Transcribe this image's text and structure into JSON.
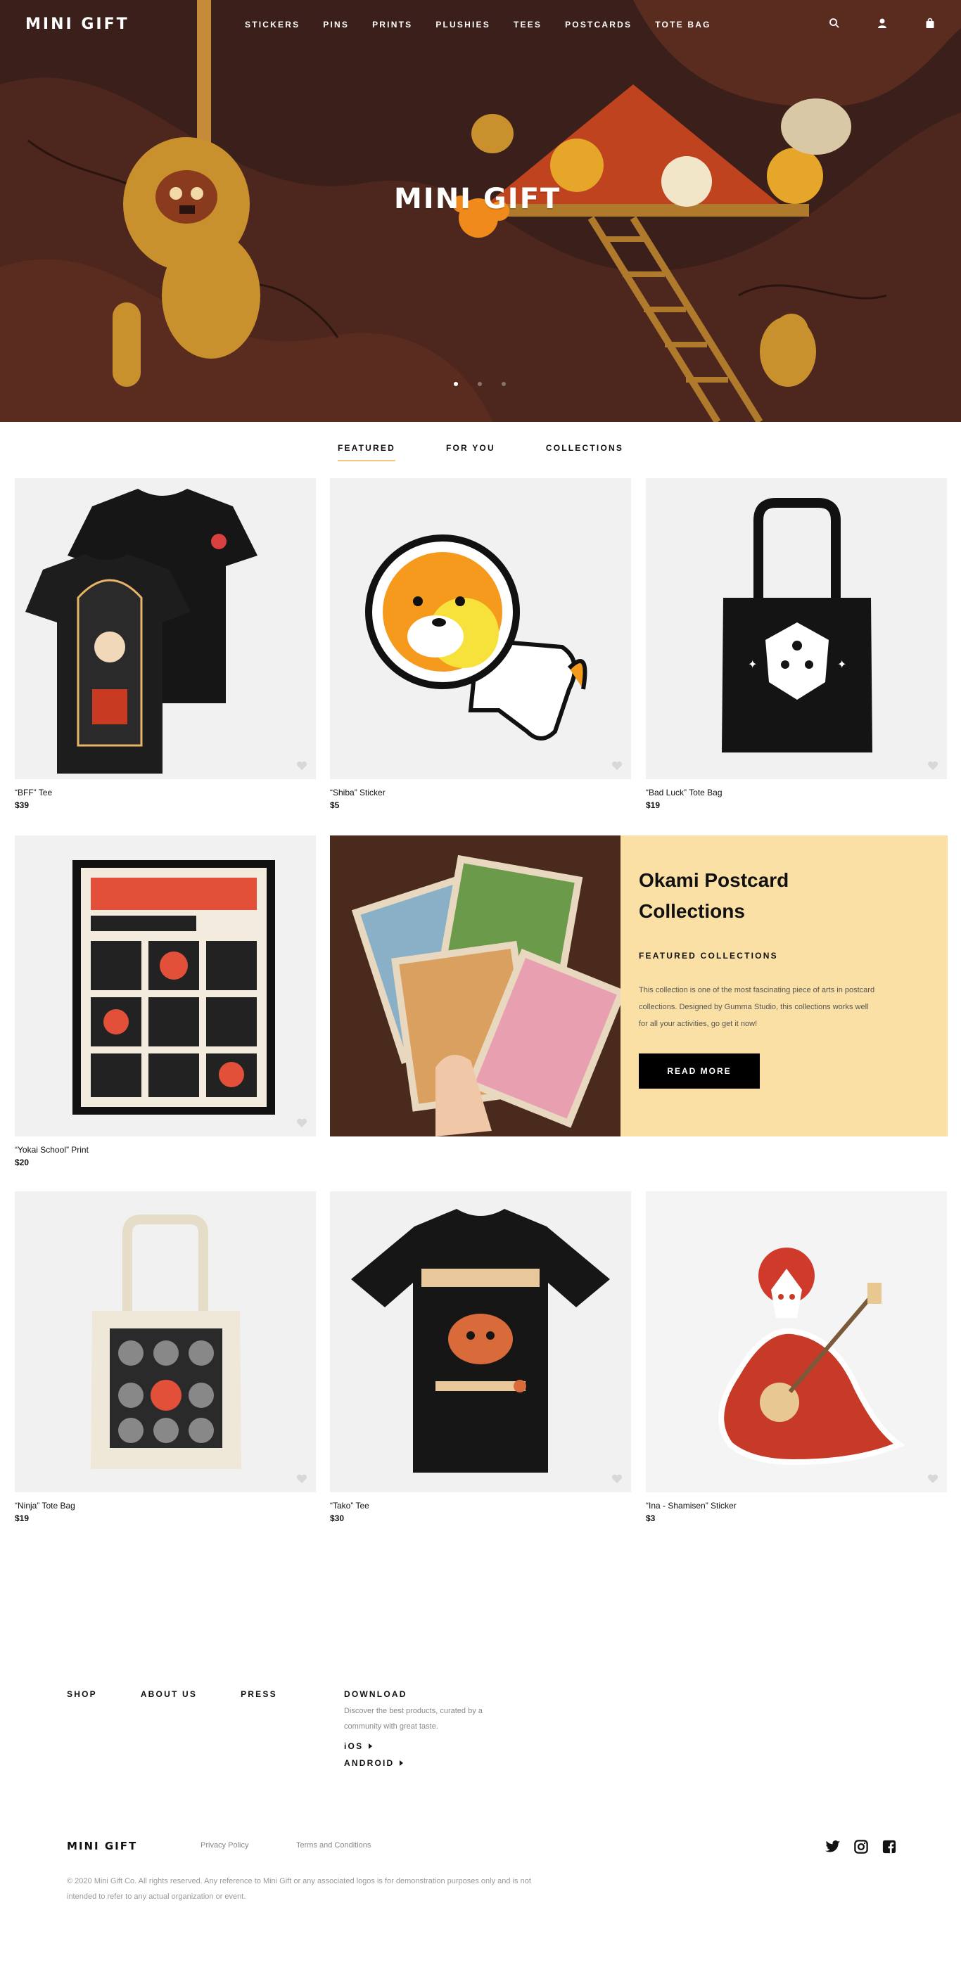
{
  "brand": {
    "logo": "MINI GIFT"
  },
  "nav": {
    "items": [
      "STICKERS",
      "PINS",
      "PRINTS",
      "PLUSHIES",
      "TEES",
      "POSTCARDS",
      "TOTE BAG"
    ],
    "icons": [
      "search-icon",
      "user-icon",
      "bag-icon"
    ]
  },
  "hero": {
    "title": "MINI GIFT",
    "slides": 3,
    "active_slide": 1
  },
  "tabs": [
    {
      "label": "FEATURED",
      "active": true
    },
    {
      "label": "FOR YOU",
      "active": false
    },
    {
      "label": "COLLECTIONS",
      "active": false
    }
  ],
  "products": [
    {
      "name": "“BFF” Tee",
      "price": "$39"
    },
    {
      "name": "“Shiba” Sticker",
      "price": "$5"
    },
    {
      "name": "“Bad Luck” Tote Bag",
      "price": "$19"
    },
    {
      "name": "“Yokai School” Print",
      "price": "$20"
    },
    {
      "name": "“Ninja” Tote Bag",
      "price": "$19"
    },
    {
      "name": "“Tako” Tee",
      "price": "$30"
    },
    {
      "name": "“Ina - Shamisen” Sticker",
      "price": "$3"
    }
  ],
  "feature": {
    "title": "Okami Postcard Collections",
    "subtitle": "FEATURED COLLECTIONS",
    "text": "This collection is one of the most fascinating piece of arts in postcard collections. Designed by Gumma Studio, this collections works well for all your activities, go get it now!",
    "button": "READ MORE"
  },
  "footer": {
    "links": [
      "SHOP",
      "ABOUT US",
      "PRESS"
    ],
    "download": {
      "heading": "DOWNLOAD",
      "text": "Discover the best products, curated by a community with great taste.",
      "ios": "iOS",
      "android": "ANDROID"
    },
    "logo": "MINI GIFT",
    "privacy": "Privacy Policy",
    "terms": "Terms and Conditions",
    "social": [
      "twitter-icon",
      "instagram-icon",
      "facebook-icon"
    ],
    "copyright": "© 2020 Mini Gift Co. All rights reserved. Any reference to Mini Gift or any associated logos is for demonstration purposes only and is not intended to refer to any actual organization or event."
  }
}
